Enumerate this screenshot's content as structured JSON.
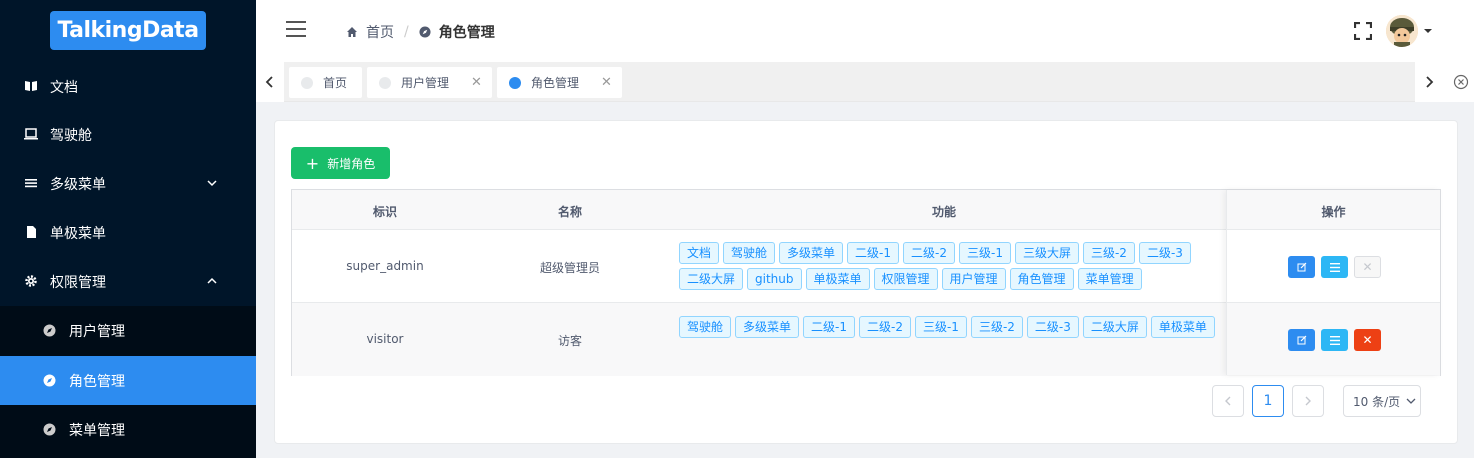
{
  "sidebar": {
    "logo": "TalkingData",
    "items": [
      {
        "label": "文档"
      },
      {
        "label": "驾驶舱"
      },
      {
        "label": "多级菜单"
      },
      {
        "label": "单极菜单"
      },
      {
        "label": "权限管理"
      }
    ],
    "subitems": [
      {
        "label": "用户管理"
      },
      {
        "label": "角色管理"
      },
      {
        "label": "菜单管理"
      }
    ],
    "active_color": "#2d8cf0"
  },
  "header": {
    "breadcrumb": [
      "首页",
      "角色管理"
    ]
  },
  "tabs": [
    {
      "label": "首页"
    },
    {
      "label": "用户管理"
    },
    {
      "label": "角色管理"
    }
  ],
  "toolbar": {
    "add_label": "新增角色"
  },
  "table": {
    "columns": [
      "标识",
      "名称",
      "功能",
      "操作"
    ],
    "rows": [
      {
        "id": "super_admin",
        "name": "超级管理员",
        "features": [
          "文档",
          "驾驶舱",
          "多级菜单",
          "二级-1",
          "二级-2",
          "三级-1",
          "三级大屏",
          "三级-2",
          "二级-3",
          "二级大屏",
          "github",
          "单极菜单",
          "权限管理",
          "用户管理",
          "角色管理",
          "菜单管理"
        ]
      },
      {
        "id": "visitor",
        "name": "访客",
        "features": [
          "驾驶舱",
          "多级菜单",
          "二级-1",
          "二级-2",
          "三级-1",
          "三级-2",
          "二级-3",
          "二级大屏",
          "单极菜单"
        ]
      }
    ]
  },
  "pagination": {
    "current_page": "1",
    "page_size": "10 条/页"
  },
  "colors": {
    "primary": "#2d8cf0",
    "success": "#19be6b",
    "danger": "#ed4014",
    "info": "#2db7f5"
  }
}
